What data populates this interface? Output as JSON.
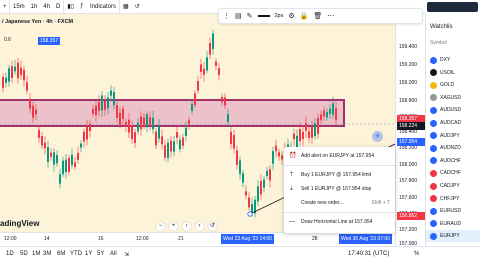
{
  "toolbar": {
    "intervals": [
      "15m",
      "1h",
      "4h",
      "D"
    ],
    "indicators_label": "Indicators",
    "pen_size": "2px"
  },
  "legend": {
    "symbol": "/ Japanese Yen · 4h · FXCM",
    "price": "158.357",
    "value_chip": "0.6"
  },
  "price_scale": {
    "labels": [
      "159.400",
      "159.200",
      "159.000",
      "158.800",
      "158.600",
      "158.400",
      "158.200",
      "158.000",
      "157.800",
      "157.600",
      "157.400",
      "157.200",
      "157.000",
      "156.800"
    ],
    "badges": [
      {
        "text": "158.357",
        "color": "#f23645"
      },
      {
        "text": "158.224",
        "color": "#131722"
      },
      {
        "text": "157.954",
        "color": "#2962ff"
      },
      {
        "text": "156.862",
        "color": "#f23645"
      }
    ]
  },
  "time_axis": {
    "labels": [
      "12:00",
      "14",
      "16",
      "12:00",
      "21",
      "28"
    ],
    "badge_left": "Wed 23 Aug '23  14:00",
    "badge_right": "Wed 30 Aug '23  07:00"
  },
  "bottom": {
    "periods": [
      "1D",
      "5D",
      "1M",
      "3M",
      "6M",
      "YTD",
      "1Y",
      "5Y",
      "All"
    ],
    "clock": "17:40:31 (UTC)"
  },
  "watermark": "adingView",
  "watchlist": {
    "title": "Watchlis",
    "column": "Symbol",
    "items": [
      {
        "name": "DXY",
        "color": "#2962ff"
      },
      {
        "name": "USOIL",
        "color": "#131722"
      },
      {
        "name": "GOLD",
        "color": "#f0b90b"
      },
      {
        "name": "XAGUSD",
        "color": "#9598a1"
      },
      {
        "name": "AUDUSD",
        "color": "#2962ff"
      },
      {
        "name": "AUDCAD",
        "color": "#2962ff"
      },
      {
        "name": "AUDJPY",
        "color": "#2962ff"
      },
      {
        "name": "AUDNZD",
        "color": "#2962ff"
      },
      {
        "name": "AUDCHF",
        "color": "#2962ff"
      },
      {
        "name": "CADCHF",
        "color": "#f23645"
      },
      {
        "name": "CADJPY",
        "color": "#f23645"
      },
      {
        "name": "CHFJPY",
        "color": "#f23645"
      },
      {
        "name": "EURUSD",
        "color": "#2962ff"
      },
      {
        "name": "EURAUD",
        "color": "#2962ff"
      },
      {
        "name": "EURJPY",
        "color": "#2962ff"
      },
      {
        "name": "EURGBP",
        "color": "#2962ff"
      },
      {
        "name": "EURJPY",
        "color": "#2962ff"
      }
    ]
  },
  "context_menu": {
    "items": [
      {
        "label": "Add alert on EURJPY at 157.954",
        "icon": "alarm-icon",
        "shortcut": ""
      },
      {
        "label": "Buy 1 EURJPY @ 157.954 limit",
        "icon": "buy-icon",
        "shortcut": ""
      },
      {
        "label": "Sell 1 EURJPY @ 157.954 stop",
        "icon": "sell-icon",
        "shortcut": ""
      },
      {
        "label": "Create new order...",
        "icon": "order-icon",
        "shortcut": "Shift + T"
      },
      {
        "label": "Draw Horizontal Line at 157.954",
        "icon": "line-icon",
        "shortcut": ""
      }
    ]
  }
}
